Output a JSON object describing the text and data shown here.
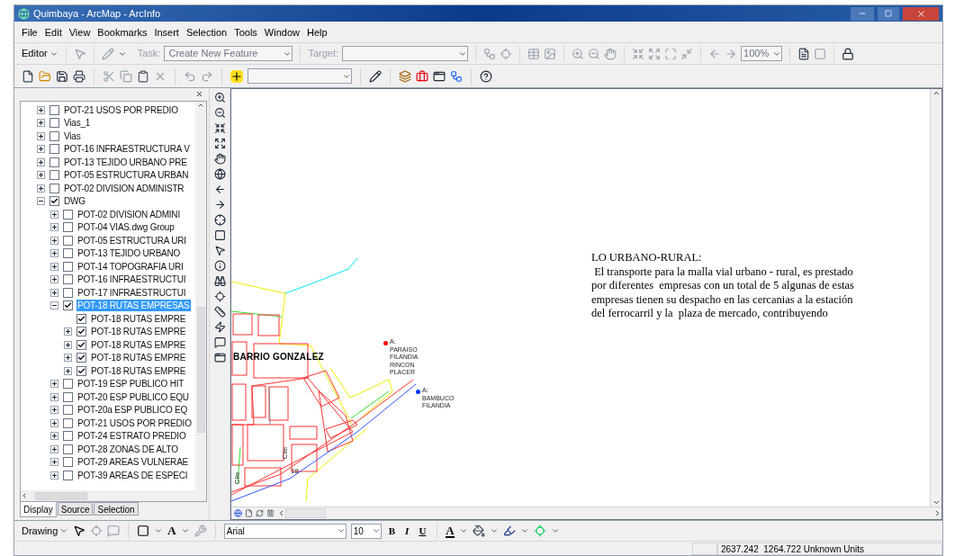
{
  "window": {
    "title": "Quimbaya - ArcMap - ArcInfo"
  },
  "menu": [
    "File",
    "Edit",
    "View",
    "Bookmarks",
    "Insert",
    "Selection",
    "Tools",
    "Window",
    "Help"
  ],
  "editor_toolbar": {
    "editor": "Editor",
    "task_label": "Task:",
    "task_value": "Create New Feature",
    "target_label": "Target:",
    "zoom_value": "100%"
  },
  "toc": {
    "layers": [
      {
        "label": "POT-21 USOS POR PREDIO",
        "kind": "group",
        "checked": false,
        "expanded": false,
        "selected": false
      },
      {
        "label": "Vias_1",
        "kind": "group",
        "checked": false,
        "expanded": false,
        "selected": false
      },
      {
        "label": "Vias",
        "kind": "group",
        "checked": false,
        "expanded": false,
        "selected": false
      },
      {
        "label": "POT-16 INFRAESTRUCTURA V",
        "kind": "group",
        "checked": false,
        "expanded": false,
        "selected": false
      },
      {
        "label": "POT-13 TEJIDO URBANO PRE",
        "kind": "group",
        "checked": false,
        "expanded": false,
        "selected": false
      },
      {
        "label": "POT-05 ESTRUCTURA URBAN",
        "kind": "group",
        "checked": false,
        "expanded": false,
        "selected": false
      },
      {
        "label": "POT-02 DIVISION ADMINISTR",
        "kind": "group",
        "checked": false,
        "expanded": false,
        "selected": false
      },
      {
        "label": "DWG",
        "kind": "group",
        "checked": true,
        "expanded": true,
        "selected": false,
        "children": [
          {
            "label": "POT-02 DIVISION ADMINI",
            "kind": "group",
            "checked": false,
            "expanded": false,
            "selected": false
          },
          {
            "label": "POT-04  VIAS.dwg Group",
            "kind": "group",
            "checked": false,
            "expanded": false,
            "selected": false
          },
          {
            "label": "POT-05 ESTRUCTURA URI",
            "kind": "group",
            "checked": false,
            "expanded": false,
            "selected": false
          },
          {
            "label": "POT-13 TEJIDO URBANO",
            "kind": "group",
            "checked": false,
            "expanded": false,
            "selected": false
          },
          {
            "label": "POT-14 TOPOGRAFIA URI",
            "kind": "group",
            "checked": false,
            "expanded": false,
            "selected": false
          },
          {
            "label": "POT-16 INFRAESTRUCTUI",
            "kind": "group",
            "checked": false,
            "expanded": false,
            "selected": false
          },
          {
            "label": "POT-17 INFRAESTRUCTUI",
            "kind": "group",
            "checked": false,
            "expanded": false,
            "selected": false
          },
          {
            "label": "POT-18 RUTAS EMPRESAS",
            "kind": "group",
            "checked": true,
            "expanded": true,
            "selected": true,
            "children": [
              {
                "label": "POT-18 RUTAS EMPRE",
                "kind": "layer",
                "checked": true,
                "selected": false
              },
              {
                "label": "POT-18 RUTAS EMPRE",
                "kind": "group",
                "checked": true,
                "expanded": false,
                "selected": false
              },
              {
                "label": "POT-18 RUTAS EMPRE",
                "kind": "group",
                "checked": true,
                "expanded": false,
                "selected": false
              },
              {
                "label": "POT-18 RUTAS EMPRE",
                "kind": "group",
                "checked": true,
                "expanded": false,
                "selected": false
              },
              {
                "label": "POT-18 RUTAS EMPRE",
                "kind": "group",
                "checked": true,
                "expanded": false,
                "selected": false
              }
            ]
          },
          {
            "label": "POT-19 ESP PUBLICO HIT",
            "kind": "group",
            "checked": false,
            "expanded": false,
            "selected": false
          },
          {
            "label": "POT-20 ESP PUBLICO EQU",
            "kind": "group",
            "checked": false,
            "expanded": false,
            "selected": false
          },
          {
            "label": "POT-20a ESP PUBLICO EQ",
            "kind": "group",
            "checked": false,
            "expanded": false,
            "selected": false
          },
          {
            "label": "POT-21 USOS POR PREDIO",
            "kind": "group",
            "checked": false,
            "expanded": false,
            "selected": false
          },
          {
            "label": "POT-24 ESTRATO PREDIO",
            "kind": "group",
            "checked": false,
            "expanded": false,
            "selected": false
          },
          {
            "label": "POT-28 ZONAS DE ALTO",
            "kind": "group",
            "checked": false,
            "expanded": false,
            "selected": false
          },
          {
            "label": "POT-29 AREAS VULNERAE",
            "kind": "group",
            "checked": false,
            "expanded": false,
            "selected": false
          },
          {
            "label": "POT-39 AREAS DE ESPECI",
            "kind": "group",
            "checked": false,
            "expanded": false,
            "selected": false
          }
        ]
      }
    ],
    "tabs": [
      {
        "label": "Display",
        "selected": true
      },
      {
        "label": "Source",
        "selected": false
      },
      {
        "label": "Selection",
        "selected": false
      }
    ]
  },
  "map": {
    "neighborhood": "BARRIO GONZALEZ",
    "points": [
      {
        "color": "#ff0000",
        "lines": [
          "A:",
          "PARAISO",
          "FILANDIA",
          "RINCON",
          "PLACER"
        ]
      },
      {
        "color": "#0033ff",
        "lines": [
          "A:",
          "BAMBUCO",
          "FILANDIA"
        ]
      }
    ],
    "street_labels": [
      "Clle",
      "Clle",
      "18"
    ],
    "text_block": [
      "LO URBANO-RURAL:",
      " El transporte para la malla vial urbano - rural, es prestado",
      "por diferentes  empresas con un total de 5 algunas de estas",
      "empresas tienen su despacho en las cercanias a la estación",
      "del ferrocarril y la  plaza de mercado, contribuyendo"
    ]
  },
  "drawing_toolbar": {
    "drawing": "Drawing",
    "text_tool": "A",
    "font": "Arial",
    "size": "10",
    "bold": "B",
    "italic": "I",
    "underline": "U",
    "font_color": "A"
  },
  "status_bar": {
    "coordinates": "2637.242  1264.722 Unknown Units"
  }
}
